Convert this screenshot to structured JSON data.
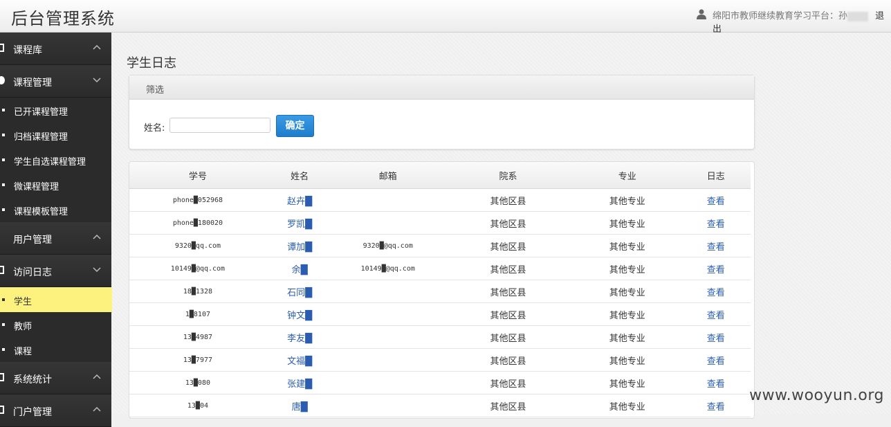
{
  "header": {
    "brand": "后台管理系统",
    "user_label": "绵阳市教师继续教育学习平台：孙",
    "logout": "退出"
  },
  "sidebar": {
    "sections": [
      {
        "label": "课程库",
        "expanded": false
      },
      {
        "label": "课程管理",
        "expanded": true,
        "items": [
          "已开课程管理",
          "归档课程管理",
          "学生自选课程管理",
          "微课程管理",
          "课程模板管理"
        ]
      },
      {
        "label": "用户管理",
        "expanded": false
      },
      {
        "label": "访问日志",
        "expanded": true,
        "items": [
          "学生",
          "教师",
          "课程"
        ],
        "active": "学生"
      },
      {
        "label": "系统统计",
        "expanded": false
      },
      {
        "label": "门户管理",
        "expanded": false
      }
    ]
  },
  "main": {
    "page_title": "学生日志",
    "filter": {
      "title": "筛选",
      "name_label": "姓名:",
      "name_value": "",
      "confirm": "确定"
    },
    "table": {
      "headers": [
        "学号",
        "姓名",
        "邮箱",
        "院系",
        "专业",
        "日志"
      ],
      "rows": [
        {
          "id": "phone█052968",
          "name": "赵卉█",
          "email": "",
          "dept": "其他区县",
          "major": "其他专业",
          "log": "查看"
        },
        {
          "id": "phone█180020",
          "name": "罗凯█",
          "email": "",
          "dept": "其他区县",
          "major": "其他专业",
          "log": "查看"
        },
        {
          "id": "9320█qq.com",
          "name": "谭加█",
          "email": "9320█@qq.com",
          "dept": "其他区县",
          "major": "其他专业",
          "log": "查看"
        },
        {
          "id": "10149█@qq.com",
          "name": "余█",
          "email": "10149█@qq.com",
          "dept": "其他区县",
          "major": "其他专业",
          "log": "查看"
        },
        {
          "id": "18█1328",
          "name": "石同█",
          "email": "",
          "dept": "其他区县",
          "major": "其他专业",
          "log": "查看"
        },
        {
          "id": "1█8107",
          "name": "钟文█",
          "email": "",
          "dept": "其他区县",
          "major": "其他专业",
          "log": "查看"
        },
        {
          "id": "13█4987",
          "name": "李友█",
          "email": "",
          "dept": "其他区县",
          "major": "其他专业",
          "log": "查看"
        },
        {
          "id": "13█7977",
          "name": "文福█",
          "email": "",
          "dept": "其他区县",
          "major": "其他专业",
          "log": "查看"
        },
        {
          "id": "13█080",
          "name": "张建█",
          "email": "",
          "dept": "其他区县",
          "major": "其他专业",
          "log": "查看"
        },
        {
          "id": "13█04",
          "name": "唐█",
          "email": "",
          "dept": "其他区县",
          "major": "其他专业",
          "log": "查看"
        }
      ]
    }
  },
  "watermark": "www.wooyun.org"
}
